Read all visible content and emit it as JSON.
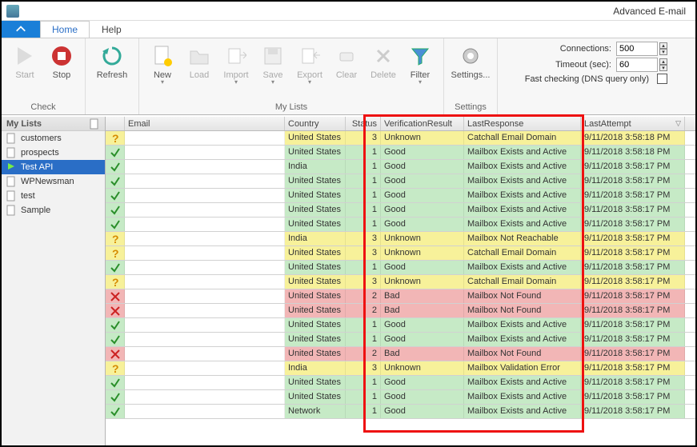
{
  "app": {
    "title": "Advanced E-mail"
  },
  "tabs": {
    "home": "Home",
    "help": "Help"
  },
  "ribbon": {
    "groups": {
      "check": "Check",
      "mylists": "My Lists",
      "settings": "Settings"
    },
    "buttons": {
      "start": "Start",
      "stop": "Stop",
      "refresh": "Refresh",
      "new": "New",
      "load": "Load",
      "import": "Import",
      "save": "Save",
      "export": "Export",
      "clear": "Clear",
      "delete": "Delete",
      "filter": "Filter",
      "settings": "Settings..."
    },
    "settings": {
      "connections_label": "Connections:",
      "connections_value": "500",
      "timeout_label": "Timeout (sec):",
      "timeout_value": "60",
      "fastcheck_label": "Fast checking (DNS query only)"
    }
  },
  "sidebar": {
    "title": "My Lists",
    "items": [
      {
        "label": "customers"
      },
      {
        "label": "prospects"
      },
      {
        "label": "Test API",
        "selected": true
      },
      {
        "label": "WPNewsman"
      },
      {
        "label": "test"
      },
      {
        "label": "Sample"
      }
    ]
  },
  "grid": {
    "headers": {
      "email": "Email",
      "country": "Country",
      "status": "Status",
      "verif": "VerificationResult",
      "resp": "LastResponse",
      "attempt": "LastAttempt"
    },
    "rows": [
      {
        "cls": "unknown",
        "icon": "q",
        "country": "United States",
        "status": "3",
        "verif": "Unknown",
        "resp": "Catchall Email Domain",
        "attempt": "9/11/2018 3:58:18 PM"
      },
      {
        "cls": "good",
        "icon": "ok",
        "country": "United States",
        "status": "1",
        "verif": "Good",
        "resp": "Mailbox Exists and Active",
        "attempt": "9/11/2018 3:58:18 PM"
      },
      {
        "cls": "good",
        "icon": "ok",
        "country": "India",
        "status": "1",
        "verif": "Good",
        "resp": "Mailbox Exists and Active",
        "attempt": "9/11/2018 3:58:17 PM"
      },
      {
        "cls": "good",
        "icon": "ok",
        "country": "United States",
        "status": "1",
        "verif": "Good",
        "resp": "Mailbox Exists and Active",
        "attempt": "9/11/2018 3:58:17 PM"
      },
      {
        "cls": "good",
        "icon": "ok",
        "country": "United States",
        "status": "1",
        "verif": "Good",
        "resp": "Mailbox Exists and Active",
        "attempt": "9/11/2018 3:58:17 PM"
      },
      {
        "cls": "good",
        "icon": "ok",
        "country": "United States",
        "status": "1",
        "verif": "Good",
        "resp": "Mailbox Exists and Active",
        "attempt": "9/11/2018 3:58:17 PM"
      },
      {
        "cls": "good",
        "icon": "ok",
        "country": "United States",
        "status": "1",
        "verif": "Good",
        "resp": "Mailbox Exists and Active",
        "attempt": "9/11/2018 3:58:17 PM"
      },
      {
        "cls": "unknown",
        "icon": "q",
        "country": "India",
        "status": "3",
        "verif": "Unknown",
        "resp": "Mailbox Not Reachable",
        "attempt": "9/11/2018 3:58:17 PM"
      },
      {
        "cls": "unknown",
        "icon": "q",
        "country": "United States",
        "status": "3",
        "verif": "Unknown",
        "resp": "Catchall Email Domain",
        "attempt": "9/11/2018 3:58:17 PM"
      },
      {
        "cls": "good",
        "icon": "ok",
        "country": "United States",
        "status": "1",
        "verif": "Good",
        "resp": "Mailbox Exists and Active",
        "attempt": "9/11/2018 3:58:17 PM"
      },
      {
        "cls": "unknown",
        "icon": "q",
        "country": "United States",
        "status": "3",
        "verif": "Unknown",
        "resp": "Catchall Email Domain",
        "attempt": "9/11/2018 3:58:17 PM"
      },
      {
        "cls": "bad",
        "icon": "x",
        "country": "United States",
        "status": "2",
        "verif": "Bad",
        "resp": "Mailbox Not Found",
        "attempt": "9/11/2018 3:58:17 PM"
      },
      {
        "cls": "bad",
        "icon": "x",
        "country": "United States",
        "status": "2",
        "verif": "Bad",
        "resp": "Mailbox Not Found",
        "attempt": "9/11/2018 3:58:17 PM"
      },
      {
        "cls": "good",
        "icon": "ok",
        "country": "United States",
        "status": "1",
        "verif": "Good",
        "resp": "Mailbox Exists and Active",
        "attempt": "9/11/2018 3:58:17 PM"
      },
      {
        "cls": "good",
        "icon": "ok",
        "country": "United States",
        "status": "1",
        "verif": "Good",
        "resp": "Mailbox Exists and Active",
        "attempt": "9/11/2018 3:58:17 PM"
      },
      {
        "cls": "bad",
        "icon": "x",
        "country": "United States",
        "status": "2",
        "verif": "Bad",
        "resp": "Mailbox Not Found",
        "attempt": "9/11/2018 3:58:17 PM"
      },
      {
        "cls": "unknown",
        "icon": "q",
        "country": "India",
        "status": "3",
        "verif": "Unknown",
        "resp": "Mailbox Validation Error",
        "attempt": "9/11/2018 3:58:17 PM"
      },
      {
        "cls": "good",
        "icon": "ok",
        "country": "United States",
        "status": "1",
        "verif": "Good",
        "resp": "Mailbox Exists and Active",
        "attempt": "9/11/2018 3:58:17 PM"
      },
      {
        "cls": "good",
        "icon": "ok",
        "country": "United States",
        "status": "1",
        "verif": "Good",
        "resp": "Mailbox Exists and Active",
        "attempt": "9/11/2018 3:58:17 PM"
      },
      {
        "cls": "good",
        "icon": "ok",
        "country": "Network",
        "status": "1",
        "verif": "Good",
        "resp": "Mailbox Exists and Active",
        "attempt": "9/11/2018 3:58:17 PM"
      }
    ]
  }
}
